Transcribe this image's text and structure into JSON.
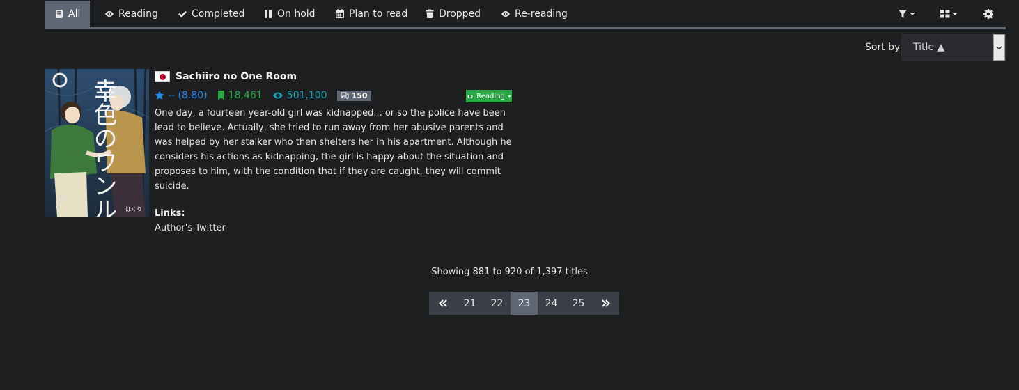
{
  "nav": {
    "tabs": [
      {
        "label": "All",
        "icon": "book-icon",
        "active": true
      },
      {
        "label": "Reading",
        "icon": "eye-icon"
      },
      {
        "label": "Completed",
        "icon": "check-icon"
      },
      {
        "label": "On hold",
        "icon": "pause-icon"
      },
      {
        "label": "Plan to read",
        "icon": "calendar-icon"
      },
      {
        "label": "Dropped",
        "icon": "trash-icon"
      },
      {
        "label": "Re-reading",
        "icon": "eye-icon"
      }
    ],
    "tools": [
      "filter-icon",
      "grid-view-icon",
      "gear-icon"
    ]
  },
  "sort": {
    "label": "Sort by",
    "value": "Title ▲"
  },
  "entry": {
    "title": "Sachiiro no One Room",
    "flag": "japan-flag-icon",
    "rating": "-- (8.80)",
    "follows": "18,461",
    "views": "501,100",
    "comments": "150",
    "status": "Reading",
    "description": "One day, a fourteen year-old girl was kidnapped... or so the police have been lead to believe. Actually, she tried to run away from her abusive parents and was helped by her stalker who then shelters her in his apartment. Although he considers his actions as kidnapping, the girl is happy about the situation and proposes to him, with the condition that if they are caught, they will commit suicide.",
    "links_label": "Links:",
    "link": "Author's Twitter",
    "cover_text": "幸色のワンルーム",
    "cover_author": "はくり"
  },
  "pagination": {
    "showing": "Showing 881 to 920 of 1,397 titles",
    "first": "«",
    "last": "»",
    "pages": [
      "21",
      "22",
      "23",
      "24",
      "25"
    ],
    "current": "23"
  },
  "colors": {
    "background": "#1e1f21",
    "nav_active": "#5e6573",
    "rating": "#1e88e5",
    "follows": "#28a745",
    "views": "#17a2b8",
    "status": "#28a745"
  }
}
